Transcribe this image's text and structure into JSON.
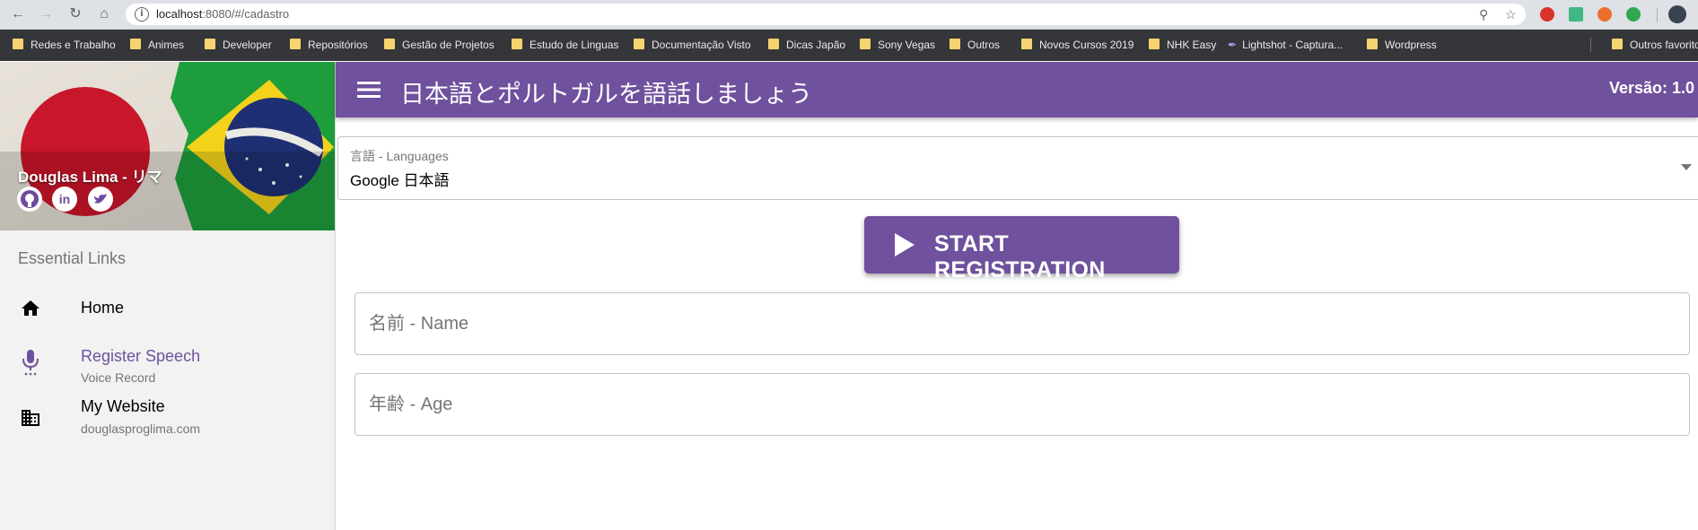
{
  "browser": {
    "url_host": "localhost",
    "url_path": ":8080/#/cadastro",
    "bookmarks": [
      "Redes e Trabalho",
      "Animes",
      "Developer",
      "Repositórios",
      "Gestão de Projetos",
      "Estudo de Linguas",
      "Documentação Visto",
      "Dicas Japão",
      "Sony Vegas",
      "Outros",
      "Novos Cursos 2019",
      "NHK Easy",
      "Lightshot - Captura...",
      "Wordpress"
    ],
    "other_bookmarks": "Outros favoritos"
  },
  "drawer": {
    "user_name": "Douglas Lima - リマ",
    "social": {
      "github": "github-icon",
      "linkedin": "in",
      "twitter": "twitter-icon"
    },
    "section_title": "Essential Links",
    "items": [
      {
        "label": "Home",
        "caption": "",
        "icon": "home-icon"
      },
      {
        "label": "Register Speech",
        "caption": "Voice Record",
        "icon": "microphone-icon"
      },
      {
        "label": "My Website",
        "caption": "douglasproglima.com",
        "icon": "building-icon"
      }
    ]
  },
  "toolbar": {
    "title": "日本語とポルトガルを語話しましょう",
    "version": "Versão: 1.0"
  },
  "form": {
    "language_label": "言語 - Languages",
    "language_value": "Google 日本語",
    "start_button": "START REGISTRATION",
    "name_placeholder": "名前 - Name",
    "age_placeholder": "年齢 - Age"
  },
  "colors": {
    "primary": "#6f519d",
    "active_nav": "#6f519d"
  }
}
